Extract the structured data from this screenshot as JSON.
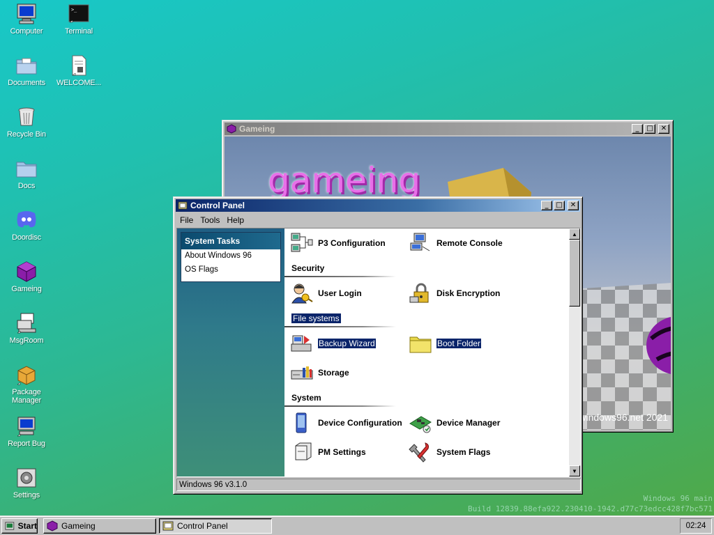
{
  "desktop": {
    "icons": [
      {
        "label": "Computer",
        "icon": "computer-icon"
      },
      {
        "label": "Terminal",
        "icon": "terminal-icon"
      },
      {
        "label": "Documents",
        "icon": "documents-folder-icon"
      },
      {
        "label": "WELCOME...",
        "icon": "text-file-icon"
      },
      {
        "label": "Recycle Bin",
        "icon": "recycle-bin-icon"
      },
      {
        "label": "Docs",
        "icon": "folder-icon"
      },
      {
        "label": "Doordisc",
        "icon": "doordisc-icon"
      },
      {
        "label": "Gameing",
        "icon": "purple-cube-icon"
      },
      {
        "label": "MsgRoom",
        "icon": "msgroom-icon"
      },
      {
        "label": "Package Manager",
        "icon": "package-icon"
      },
      {
        "label": "Report Bug",
        "icon": "report-bug-icon"
      },
      {
        "label": "Settings",
        "icon": "settings-icon"
      }
    ],
    "watermark": {
      "line1": "Windows 96 main",
      "line2": "Build 12839.88efa922.230410-1942.d77c73edcc428f7bc571"
    }
  },
  "game_window": {
    "title": "Gameing",
    "game_title_text": "gameing",
    "credit": "windows96.net 2021"
  },
  "control_panel": {
    "title": "Control Panel",
    "menu": [
      "File",
      "Tools",
      "Help"
    ],
    "tasks": {
      "heading": "System Tasks",
      "links": [
        "About Windows 96",
        "OS Flags"
      ]
    },
    "sections": {
      "security": "Security",
      "file_systems": "File systems",
      "system": "System"
    },
    "items": {
      "p3_config": "P3 Configuration",
      "remote_console": "Remote Console",
      "user_login": "User Login",
      "disk_encryption": "Disk Encryption",
      "backup_wizard": "Backup Wizard",
      "boot_folder": "Boot Folder",
      "storage": "Storage",
      "device_config": "Device Configuration",
      "device_manager": "Device Manager",
      "pm_settings": "PM Settings",
      "system_flags": "System Flags"
    },
    "status": "Windows 96 v3.1.0"
  },
  "taskbar": {
    "start": "Start",
    "tasks": [
      "Gameing",
      "Control Panel"
    ],
    "active_task": "Control Panel",
    "clock": "02:24"
  }
}
